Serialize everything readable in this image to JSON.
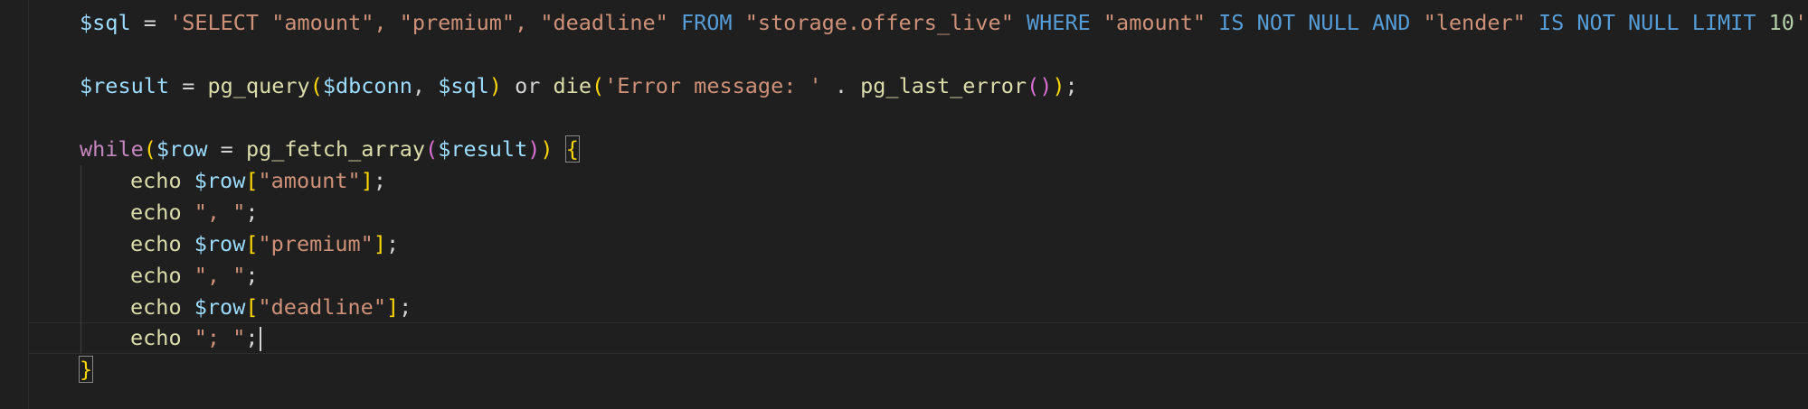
{
  "editor": {
    "language": "php",
    "line1": {
      "var": "$sql",
      "assign": " = ",
      "str_open": "'SELECT \"amount\", \"premium\", \"deadline\" ",
      "kw_from": "FROM",
      "str_table": " \"storage.offers_live\" ",
      "kw_where": "WHERE",
      "str_amount": " \"amount\" ",
      "kw_isnotnull1": "IS NOT NULL AND",
      "str_lender": " \"lender\" ",
      "kw_isnotnull2": "IS NOT NULL LIMIT",
      "space": " ",
      "num": "10",
      "str_close": "'",
      "semi": ";"
    },
    "line2": {
      "var_result": "$result",
      "assign": " = ",
      "fn_query": "pg_query",
      "paren_open": "(",
      "var_dbconn": "$dbconn",
      "comma": ", ",
      "var_sql": "$sql",
      "paren_close": ")",
      "kw_or": " or ",
      "fn_die": "die",
      "paren2_open": "(",
      "str_error": "'Error message: '",
      "concat": " . ",
      "fn_lasterror": "pg_last_error",
      "paren3": "()",
      "paren2_close": ")",
      "semi": ";"
    },
    "line3": {
      "kw_while": "while",
      "paren_open": "(",
      "var_row": "$row",
      "assign": " = ",
      "fn_fetch": "pg_fetch_array",
      "paren2_open": "(",
      "var_result": "$result",
      "paren2_close": ")",
      "paren_close": ")",
      "space": " ",
      "brace_open": "{"
    },
    "body_lines": [
      {
        "echo": "echo",
        "sp": " ",
        "var": "$row",
        "b_open": "[",
        "str": "\"amount\"",
        "b_close": "]",
        "semi": ";"
      },
      {
        "echo": "echo",
        "sp": " ",
        "str": "\", \"",
        "semi": ";"
      },
      {
        "echo": "echo",
        "sp": " ",
        "var": "$row",
        "b_open": "[",
        "str": "\"premium\"",
        "b_close": "]",
        "semi": ";"
      },
      {
        "echo": "echo",
        "sp": " ",
        "str": "\", \"",
        "semi": ";"
      },
      {
        "echo": "echo",
        "sp": " ",
        "var": "$row",
        "b_open": "[",
        "str": "\"deadline\"",
        "b_close": "]",
        "semi": ";"
      },
      {
        "echo": "echo",
        "sp": " ",
        "str": "\"; \"",
        "semi": ";"
      }
    ],
    "closing": {
      "brace_close": "}"
    }
  },
  "colors": {
    "background": "#1f1f1f",
    "variable": "#9cdcfe",
    "string": "#ce9178",
    "sql_keyword": "#569cd6",
    "number": "#b5cea8",
    "function": "#dcdcaa",
    "control": "#c586c0",
    "bracket_level1": "#ffd700",
    "bracket_level2": "#da70d6",
    "bracket_level3": "#179fff"
  }
}
